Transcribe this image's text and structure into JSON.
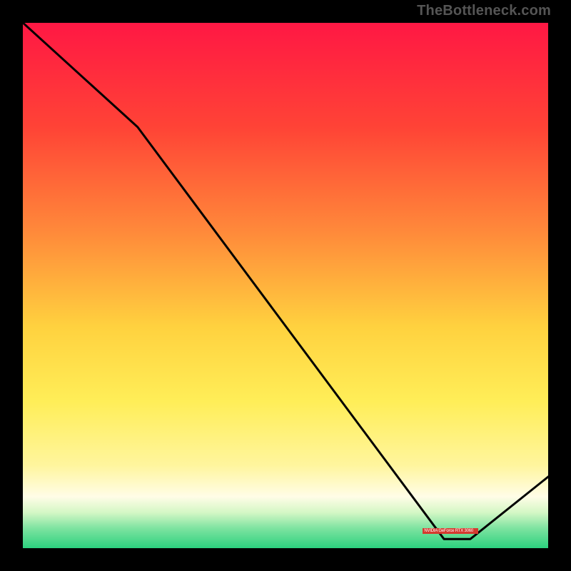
{
  "watermark": "TheBottleneck.com",
  "label_text": "NVIDIA GeForce RTX 3060",
  "gradient_stops": [
    {
      "offset": 0,
      "color": "#ff1744"
    },
    {
      "offset": 20,
      "color": "#ff4336"
    },
    {
      "offset": 40,
      "color": "#ff8a3a"
    },
    {
      "offset": 58,
      "color": "#ffd23f"
    },
    {
      "offset": 72,
      "color": "#ffee58"
    },
    {
      "offset": 84,
      "color": "#fff59d"
    },
    {
      "offset": 90,
      "color": "#fffde7"
    },
    {
      "offset": 93,
      "color": "#d4f7c5"
    },
    {
      "offset": 96,
      "color": "#7de3a0"
    },
    {
      "offset": 100,
      "color": "#26d07c"
    }
  ],
  "chart_data": {
    "type": "line",
    "title": "",
    "xlabel": "",
    "ylabel": "",
    "xlim": [
      0,
      100
    ],
    "ylim": [
      0,
      100
    ],
    "series": [
      {
        "name": "bottleneck-curve",
        "x": [
          0,
          22,
          80,
          85,
          100
        ],
        "y": [
          100,
          80,
          2,
          2,
          14
        ]
      }
    ],
    "label_marker": {
      "text_key": "label_text",
      "x_start": 76,
      "x_end": 86,
      "y": 3.5
    }
  }
}
